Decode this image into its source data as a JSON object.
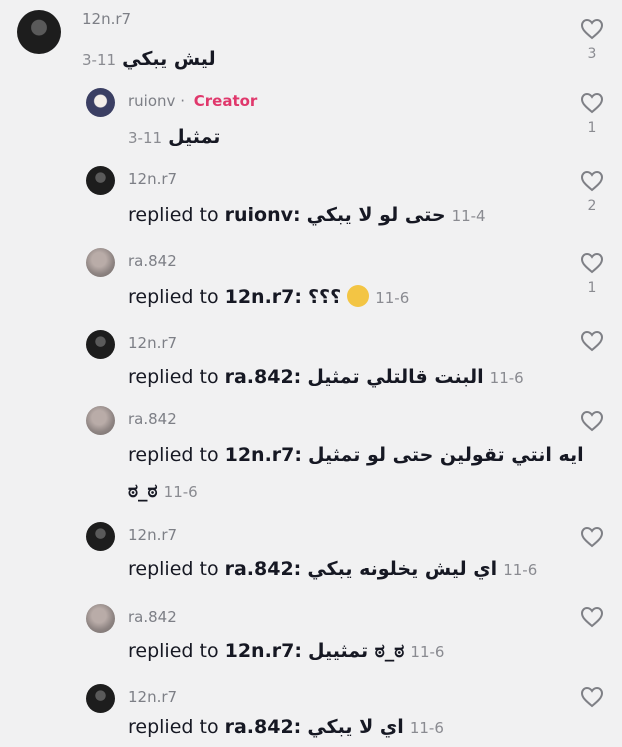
{
  "comments": [
    {
      "username": "12n.r7",
      "creator": "",
      "text": "ليش يبكي",
      "date": "3-11",
      "reply_target": "",
      "likes": "3"
    },
    {
      "username": "ruionv",
      "creator": "Creator",
      "text": "تمثيل",
      "date": "3-11",
      "reply_target": "",
      "likes": "1"
    },
    {
      "username": "12n.r7",
      "creator": "",
      "text": "حتى لو لا يبكي",
      "date": "11-4",
      "reply_target": "ruionv:",
      "likes": "2"
    },
    {
      "username": "ra.842",
      "creator": "",
      "text": "؟؟؟",
      "date": "11-6",
      "reply_target": "12n.r7:",
      "likes": "1"
    },
    {
      "username": "12n.r7",
      "creator": "",
      "text": "البنت قالتلي تمثيل",
      "date": "11-6",
      "reply_target": "ra.842:",
      "likes": ""
    },
    {
      "username": "ra.842",
      "creator": "",
      "text": "ايه انتي تقولين حتى لو تمثيل",
      "text2": "ಠ_ಠ",
      "date": "11-6",
      "reply_target": "12n.r7:",
      "likes": ""
    },
    {
      "username": "12n.r7",
      "creator": "",
      "text": "اي ليش يخلونه يبكي",
      "date": "11-6",
      "reply_target": "ra.842:",
      "likes": ""
    },
    {
      "username": "ra.842",
      "creator": "",
      "text": "ಠ_ಠ تمثييل",
      "date": "11-6",
      "reply_target": "12n.r7:",
      "likes": ""
    },
    {
      "username": "12n.r7",
      "creator": "",
      "text": "اي لا يبكي",
      "date": "11-6",
      "reply_target": "ra.842:",
      "likes": ""
    }
  ],
  "reply_prefix": "replied to ",
  "creator_separator": "·",
  "icons": {
    "like": "heart-outline-icon",
    "emoji": "slightly-smiling-face-emoji"
  },
  "colors": {
    "creator": "#e0386c",
    "meta": "#8a8b91",
    "text": "#161823",
    "background": "#f1f1f2"
  }
}
